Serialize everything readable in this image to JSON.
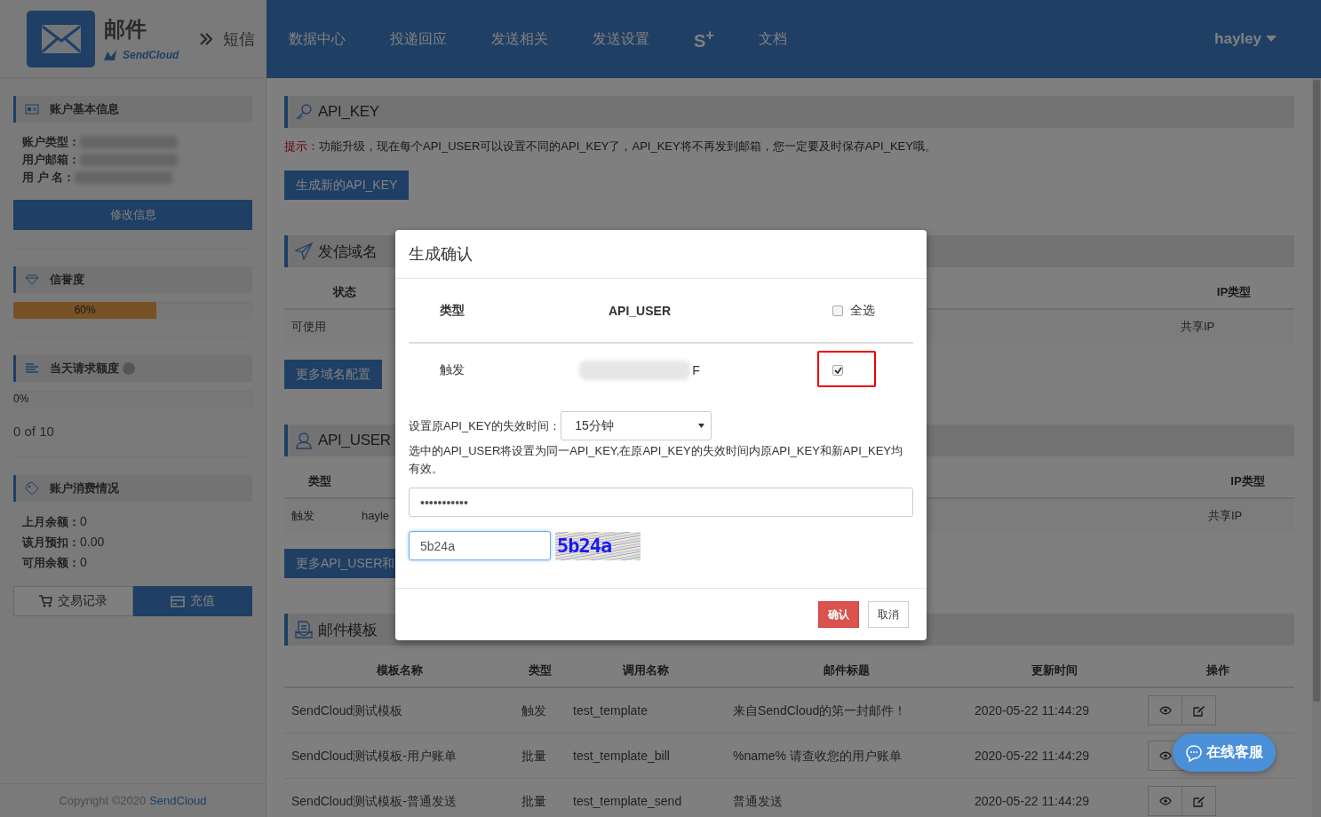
{
  "header": {
    "brand_title": "邮件",
    "brand_sub": "SendCloud",
    "switch_label": "短信",
    "nav": [
      {
        "label": "数据中心"
      },
      {
        "label": "投递回应"
      },
      {
        "label": "发送相关"
      },
      {
        "label": "发送设置"
      },
      {
        "label": "S$^{+}$"
      },
      {
        "label": "文档"
      }
    ],
    "user": "hayley"
  },
  "sidebar": {
    "sections": [
      {
        "kind": "account",
        "title": "账户基本信息",
        "fields": [
          {
            "label": "账户类型："
          },
          {
            "label": "用户邮箱："
          },
          {
            "label": "用 户 名："
          }
        ],
        "button": "修改信息"
      },
      {
        "kind": "reputation",
        "title": "信誉度",
        "level": 0.6,
        "reading": "60%"
      },
      {
        "kind": "quota",
        "title": "当天请求额度",
        "level": 0,
        "reading": "0%",
        "count": "0 of 10"
      },
      {
        "kind": "billing",
        "title": "账户消费情况",
        "lines": [
          {
            "label": "上月余额：",
            "value": "0"
          },
          {
            "label": "该月预扣：",
            "value": "0.00"
          },
          {
            "label": "可用余额：",
            "value": "0"
          }
        ],
        "buttons": [
          {
            "label": "交易记录",
            "kind": "history"
          },
          {
            "label": "充值",
            "kind": "recharge"
          }
        ]
      }
    ],
    "footer": {
      "text": "Copyright ©2020",
      "link": "SendCloud"
    }
  },
  "main": {
    "sections": [
      {
        "kind": "api_key",
        "title": "API_KEY",
        "tip_label": "提示：",
        "tip": "功能升级，现在每个API_USER可以设置不同的API_KEY了，API_KEY将不再发到邮箱，您一定要及时保存API_KEY哦。",
        "button": "生成新的API_KEY"
      },
      {
        "kind": "domain",
        "title": "发信域名",
        "columns": [
          "状态",
          "IP类型"
        ],
        "rows": [
          [
            "可使用",
            "共享IP"
          ]
        ],
        "button": "更多域名配置"
      },
      {
        "kind": "api_user",
        "title": "API_USER",
        "columns": [
          "类型",
          "IP类型"
        ],
        "rows": [
          [
            "触发",
            "hayle",
            "共享IP"
          ]
        ],
        "button": "更多API_USER和"
      },
      {
        "kind": "templates",
        "title": "邮件模板",
        "columns": [
          "模板名称",
          "类型",
          "调用名称",
          "邮件标题",
          "更新时间",
          "操作"
        ],
        "rows": [
          [
            "SendCloud测试模板",
            "触发",
            "test_template",
            "来自SendCloud的第一封邮件！",
            "2020-05-22 11:44:29"
          ],
          [
            "SendCloud测试模板-用户账单",
            "批量",
            "test_template_bill",
            "%name% 请查收您的用户账单",
            "2020-05-22 11:44:29"
          ],
          [
            "SendCloud测试模板-普通发送",
            "批量",
            "test_template_send",
            "普通发送",
            "2020-05-22 11:44:29"
          ]
        ]
      }
    ]
  },
  "modal": {
    "title": "生成确认",
    "columns": [
      "类型",
      "API_USER"
    ],
    "select_all": {
      "label": "全选",
      "checked": false
    },
    "rows": [
      {
        "type": "触发",
        "api_user": "F",
        "checked": true,
        "highlighted": true
      }
    ],
    "expiry_label": "设置原API_KEY的失效时间：",
    "expiry_value": "15分钟",
    "note": "选中的API_USER将设置为同一API_KEY,在原API_KEY的失效时间内原API_KEY和新API_KEY均有效。",
    "password": "•••••••••••",
    "captcha_value": "5b24a",
    "captcha_text": "5b24a",
    "buttons": [
      {
        "label": "确认",
        "kind": "primary"
      },
      {
        "label": "取消",
        "kind": "default"
      }
    ]
  },
  "chat_button": {
    "label": "在线客服"
  }
}
